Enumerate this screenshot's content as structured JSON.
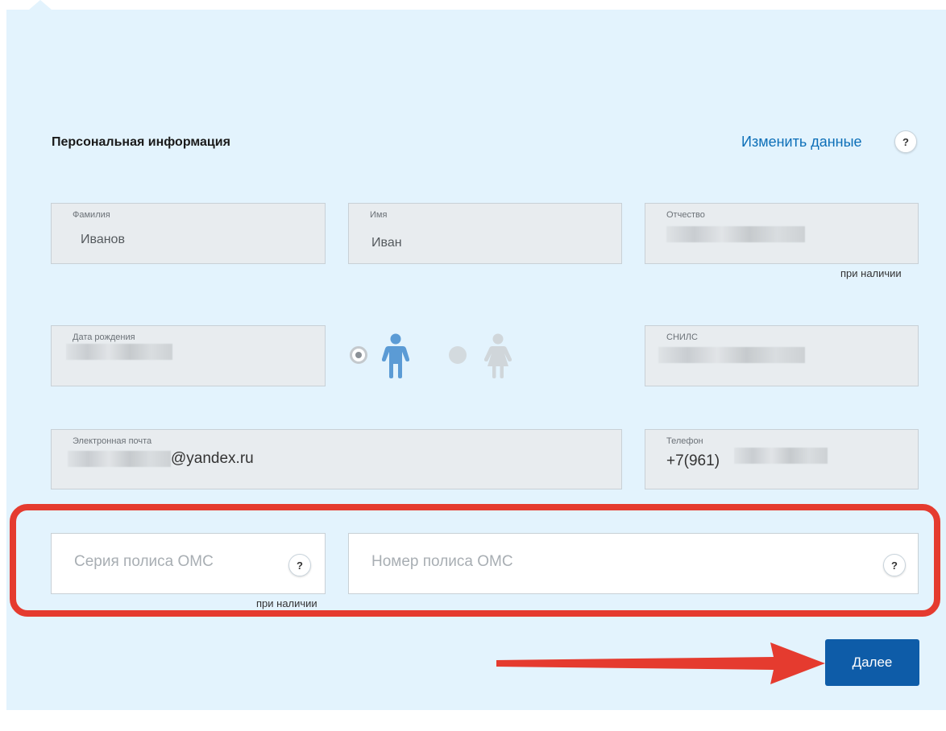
{
  "section": {
    "title": "Персональная информация",
    "edit_link": "Изменить данные",
    "help": "?"
  },
  "fields": {
    "surname": {
      "label": "Фамилия",
      "value": "Иванов"
    },
    "name": {
      "label": "Имя",
      "value": "Иван"
    },
    "patronymic": {
      "label": "Отчество",
      "note": "при наличии"
    },
    "birthdate": {
      "label": "Дата рождения"
    },
    "snils": {
      "label": "СНИЛС"
    },
    "email": {
      "label": "Электронная почта",
      "value_suffix": "@yandex.ru"
    },
    "phone": {
      "label": "Телефон",
      "value_prefix": "+7(961)"
    }
  },
  "gender": {
    "selected": "male",
    "male_icon": "male-person-icon",
    "female_icon": "female-person-icon"
  },
  "oms": {
    "series_placeholder": "Серия полиса ОМС",
    "series_note": "при наличии",
    "number_placeholder": "Номер полиса ОМС",
    "help": "?"
  },
  "actions": {
    "next_label": "Далее"
  },
  "colors": {
    "panel_bg": "#e3f3fd",
    "link": "#0d6fb8",
    "male_icon": "#5b9bd5",
    "female_icon": "#d0d6da",
    "highlight": "#e53b2f",
    "primary_button": "#0e5ca8"
  }
}
